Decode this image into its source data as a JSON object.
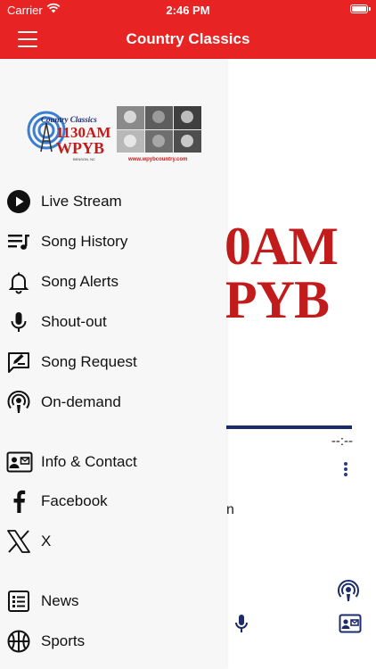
{
  "status_bar": {
    "carrier": "Carrier",
    "time": "2:46 PM"
  },
  "nav": {
    "title": "Country Classics"
  },
  "drawer": {
    "logo": {
      "line1": "Country Classics",
      "line2": "1130AM",
      "line3": "WPYB",
      "line4": "BENSON, NC",
      "url": "www.wpybcountry.com"
    },
    "items": [
      {
        "label": "Live Stream",
        "icon": "play-circle-icon"
      },
      {
        "label": "Song History",
        "icon": "playlist-icon"
      },
      {
        "label": "Song Alerts",
        "icon": "bell-icon"
      },
      {
        "label": "Shout-out",
        "icon": "microphone-icon"
      },
      {
        "label": "Song Request",
        "icon": "request-icon"
      },
      {
        "label": "On-demand",
        "icon": "podcast-icon"
      },
      {
        "label": "Info & Contact",
        "icon": "contact-card-icon"
      },
      {
        "label": "Facebook",
        "icon": "facebook-icon"
      },
      {
        "label": "X",
        "icon": "x-icon"
      },
      {
        "label": "News",
        "icon": "news-icon"
      },
      {
        "label": "Sports",
        "icon": "sports-icon"
      }
    ]
  },
  "background": {
    "logo_line1": "0AM",
    "logo_line2": "PYB",
    "time": "--:--",
    "partial_text": "n"
  },
  "colors": {
    "brand_red": "#e82323",
    "accent_navy": "#1c2b6b",
    "logo_red": "#c11b1b"
  }
}
